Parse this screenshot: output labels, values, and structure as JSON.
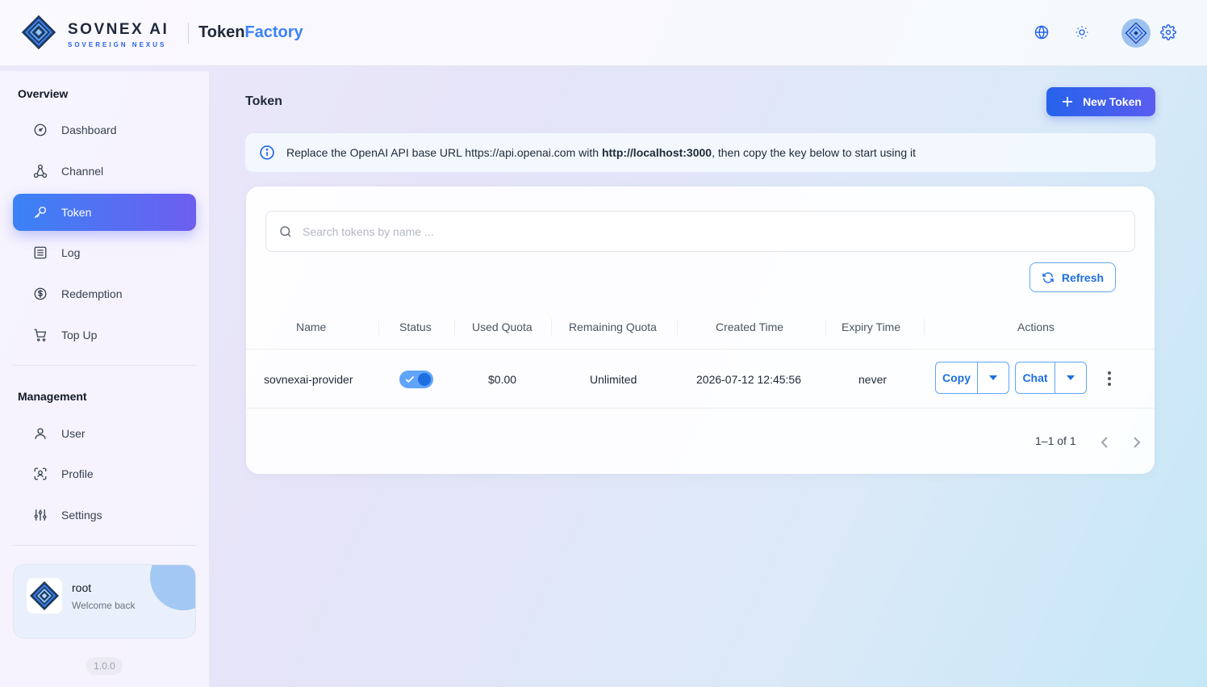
{
  "brand": {
    "name": "SOVNEX AI",
    "sub": "SOVEREIGN NEXUS"
  },
  "app": {
    "title_part1": "Token",
    "title_part2": "Factory"
  },
  "header": {
    "icons": [
      "globe-icon",
      "sun-icon",
      "avatar",
      "gear-icon"
    ]
  },
  "sidebar": {
    "overview_title": "Overview",
    "overview_items": [
      {
        "label": "Dashboard",
        "icon": "dashboard-icon"
      },
      {
        "label": "Channel",
        "icon": "channel-icon"
      },
      {
        "label": "Token",
        "icon": "key-icon",
        "active": true
      },
      {
        "label": "Log",
        "icon": "log-icon"
      },
      {
        "label": "Redemption",
        "icon": "dollar-icon"
      },
      {
        "label": "Top Up",
        "icon": "cart-icon"
      }
    ],
    "management_title": "Management",
    "management_items": [
      {
        "label": "User",
        "icon": "user-icon"
      },
      {
        "label": "Profile",
        "icon": "profile-icon"
      },
      {
        "label": "Settings",
        "icon": "sliders-icon"
      }
    ],
    "user": {
      "name": "root",
      "subtitle": "Welcome back"
    },
    "version": "1.0.0"
  },
  "main": {
    "title": "Token",
    "new_token_label": "New Token",
    "info": {
      "prefix": "Replace the OpenAI API base URL https://api.openai.com with ",
      "url": "http://localhost:3000",
      "suffix": ", then copy the key below to start using it"
    },
    "search_placeholder": "Search tokens by name ...",
    "refresh_label": "Refresh",
    "columns": [
      "Name",
      "Status",
      "Used Quota",
      "Remaining Quota",
      "Created Time",
      "Expiry Time",
      "Actions"
    ],
    "rows": [
      {
        "name": "sovnexai-provider",
        "status_enabled": true,
        "used_quota": "$0.00",
        "remaining_quota": "Unlimited",
        "created_time": "2026-07-12 12:45:56",
        "expiry_time": "never",
        "copy_label": "Copy",
        "chat_label": "Chat"
      }
    ],
    "pagination": "1–1 of 1"
  },
  "colors": {
    "accent": "#2563eb",
    "accent2": "#6d5ef0",
    "link": "#1d6fe0"
  }
}
